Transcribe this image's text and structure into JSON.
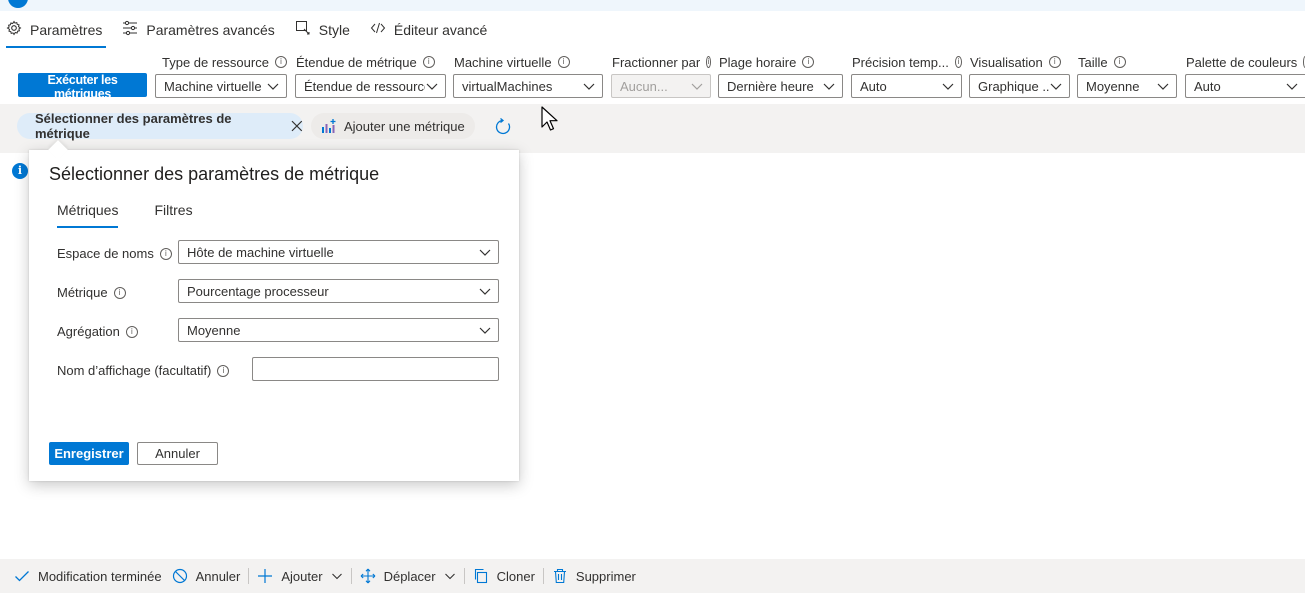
{
  "tabs": [
    {
      "label": "Paramètres",
      "icon": "gear-icon",
      "active": true
    },
    {
      "label": "Paramètres avancés",
      "icon": "sliders-icon",
      "active": false
    },
    {
      "label": "Style",
      "icon": "style-icon",
      "active": false
    },
    {
      "label": "Éditeur avancé",
      "icon": "code-icon",
      "active": false
    }
  ],
  "toolbar": {
    "run_label": "Exécuter les métriques",
    "fields": [
      {
        "label": "Type de ressource",
        "value": "Machine virtuelle"
      },
      {
        "label": "Étendue de métrique",
        "value": "Étendue de ressource"
      },
      {
        "label": "Machine virtuelle",
        "value": "virtualMachines"
      },
      {
        "label": "Fractionner par",
        "value": "Aucun...",
        "disabled": true
      },
      {
        "label": "Plage horaire",
        "value": "Dernière heure"
      },
      {
        "label": "Précision temp...",
        "value": "Auto"
      },
      {
        "label": "Visualisation",
        "value": "Graphique ..."
      },
      {
        "label": "Taille",
        "value": "Moyenne"
      },
      {
        "label": "Palette de couleurs",
        "value": "Auto"
      }
    ]
  },
  "pills": {
    "select_label": "Sélectionner des paramètres de métrique",
    "add_label": "Ajouter une métrique"
  },
  "dialog": {
    "title": "Sélectionner des paramètres de métrique",
    "tabs": [
      "Métriques",
      "Filtres"
    ],
    "namespace_label": "Espace de noms",
    "namespace_value": "Hôte de machine virtuelle",
    "metric_label": "Métrique",
    "metric_value": "Pourcentage processeur",
    "aggregation_label": "Agrégation",
    "aggregation_value": "Moyenne",
    "display_name_label": "Nom d’affichage (facultatif)",
    "display_name_value": "",
    "save_label": "Enregistrer",
    "cancel_label": "Annuler"
  },
  "bottombar": {
    "done_label": "Modification terminée",
    "cancel_label": "Annuler",
    "add_label": "Ajouter",
    "move_label": "Déplacer",
    "clone_label": "Cloner",
    "delete_label": "Supprimer"
  },
  "colors": {
    "accent": "#0078d4",
    "pill_selected": "#deecf9",
    "bar_bg": "#f3f2f1"
  }
}
